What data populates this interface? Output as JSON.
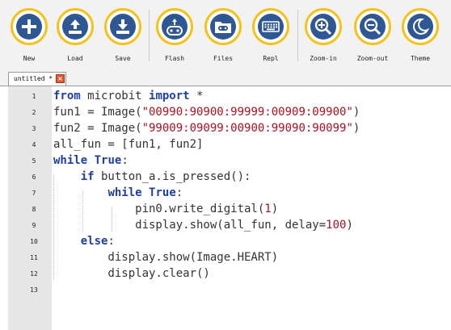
{
  "toolbar": {
    "buttons": [
      {
        "label": "New",
        "icon": "plus-icon"
      },
      {
        "label": "Load",
        "icon": "upload-icon"
      },
      {
        "label": "Save",
        "icon": "download-icon"
      },
      {
        "label": "Flash",
        "icon": "microbit-icon"
      },
      {
        "label": "Files",
        "icon": "files-icon"
      },
      {
        "label": "Repl",
        "icon": "keyboard-icon"
      },
      {
        "label": "Zoom-in",
        "icon": "zoom-in-icon"
      },
      {
        "label": "Zoom-out",
        "icon": "zoom-out-icon"
      },
      {
        "label": "Theme",
        "icon": "moon-icon"
      }
    ]
  },
  "tab": {
    "label": "untitled *",
    "close": "×"
  },
  "editor": {
    "line_numbers": [
      "1",
      "2",
      "3",
      "4",
      "5",
      "6",
      "7",
      "8",
      "9",
      "10",
      "11",
      "12",
      "13"
    ],
    "lines": [
      [
        {
          "t": "from",
          "c": "kw"
        },
        {
          "t": " microbit ",
          "c": ""
        },
        {
          "t": "import",
          "c": "kw"
        },
        {
          "t": " *",
          "c": ""
        }
      ],
      [
        {
          "t": "fun1 = Image(",
          "c": ""
        },
        {
          "t": "\"00990:90900:99999:00909:09900\"",
          "c": "str"
        },
        {
          "t": ")",
          "c": ""
        }
      ],
      [
        {
          "t": "fun2 = Image(",
          "c": ""
        },
        {
          "t": "\"99009:09099:00900:99090:90099\"",
          "c": "str"
        },
        {
          "t": ")",
          "c": ""
        }
      ],
      [
        {
          "t": "all_fun = [fun1, fun2]",
          "c": ""
        }
      ],
      [
        {
          "t": "while",
          "c": "kw"
        },
        {
          "t": " ",
          "c": ""
        },
        {
          "t": "True",
          "c": "kw"
        },
        {
          "t": ":",
          "c": ""
        }
      ],
      [
        {
          "t": "    ",
          "c": ""
        },
        {
          "t": "if",
          "c": "kw"
        },
        {
          "t": " button_a.is_pressed():",
          "c": ""
        }
      ],
      [
        {
          "t": "        ",
          "c": ""
        },
        {
          "t": "while",
          "c": "kw"
        },
        {
          "t": " ",
          "c": ""
        },
        {
          "t": "True",
          "c": "kw"
        },
        {
          "t": ":",
          "c": ""
        }
      ],
      [
        {
          "t": "            pin0.write_digital(",
          "c": ""
        },
        {
          "t": "1",
          "c": "num"
        },
        {
          "t": ")",
          "c": ""
        }
      ],
      [
        {
          "t": "            display.show(all_fun, delay=",
          "c": ""
        },
        {
          "t": "100",
          "c": "num"
        },
        {
          "t": ")",
          "c": ""
        }
      ],
      [
        {
          "t": "    ",
          "c": ""
        },
        {
          "t": "else",
          "c": "kw"
        },
        {
          "t": ":",
          "c": ""
        }
      ],
      [
        {
          "t": "        display.show(Image.HEART)",
          "c": ""
        }
      ],
      [
        {
          "t": "        display.clear()",
          "c": ""
        }
      ],
      []
    ]
  },
  "colors": {
    "accent_ring": "#f5c21a",
    "icon_blue": "#2e5794",
    "keyword": "#1f3fa3",
    "string": "#b01020"
  }
}
